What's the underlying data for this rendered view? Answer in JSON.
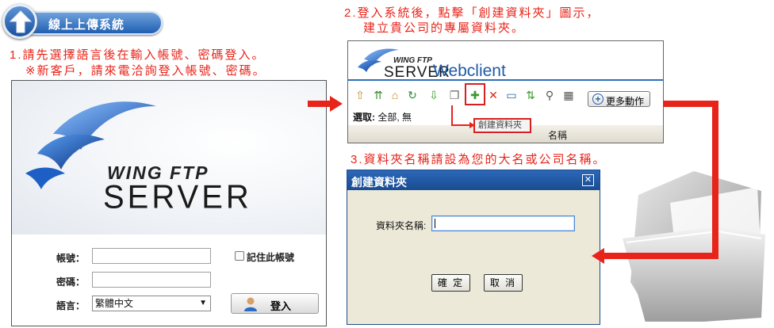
{
  "badge": {
    "title": "線上上傳系統"
  },
  "steps": {
    "step1_line1": "1.請先選擇語言後在輸入帳號、密碼登入。",
    "step1_line2": "※新客戶，請來電洽詢登入帳號、密碼。",
    "step2_line1": "2.登入系統後，點擊「創建資料夾」圖示，",
    "step2_line2": "建立貴公司的專屬資料夾。",
    "step3": "3.資料夾名稱請設為您的大名或公司名稱。"
  },
  "login": {
    "logo_top": "WING FTP",
    "logo_bottom": "SERVER",
    "account_label": "帳號：",
    "account_value": "",
    "password_label": "密碼：",
    "password_value": "",
    "remember_label": "記住此帳號",
    "language_label": "語言：",
    "language_value": "繁體中文",
    "login_button": "登入"
  },
  "webclient": {
    "logo_top": "WING FTP",
    "logo_bottom": "SERVER",
    "title": "Webclient",
    "toolbar_icons": [
      "upload-icon",
      "upload-multiple-icon",
      "home-icon",
      "refresh-icon",
      "download-icon",
      "copy-icon",
      "create-folder-icon",
      "delete-icon",
      "rename-icon",
      "sort-icon",
      "search-icon",
      "grid-icon"
    ],
    "more_actions": "更多動作",
    "select_label": "選取:",
    "select_value": "全部, 無",
    "column_name": "名稱",
    "tooltip": "創建資料夾"
  },
  "dialog": {
    "title": "創建資料夾",
    "close": "✕",
    "folder_name_label": "資料夾名稱:",
    "folder_name_value": "",
    "ok_button": "確 定",
    "cancel_button": "取 消"
  },
  "colors": {
    "accent_red": "#e8241a",
    "brand_blue": "#1e5aa8"
  }
}
